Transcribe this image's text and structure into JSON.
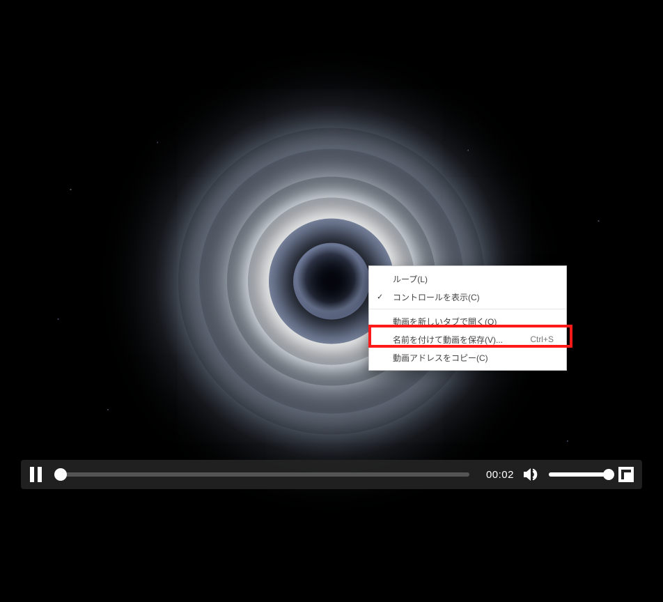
{
  "player": {
    "time_elapsed": "00:02",
    "progress_percent": 1.5,
    "volume_percent": 100
  },
  "context_menu": {
    "items": {
      "loop": {
        "label": "ループ(L)",
        "checked": false
      },
      "show_ctrls": {
        "label": "コントロールを表示(C)",
        "checked": true
      },
      "open_new_tab": {
        "label": "動画を新しいタブで開く(O)"
      },
      "save_as": {
        "label": "名前を付けて動画を保存(V)...",
        "shortcut": "Ctrl+S",
        "highlighted": true
      },
      "copy_address": {
        "label": "動画アドレスをコピー(C)"
      }
    }
  },
  "highlight_color": "#ff1a1a"
}
